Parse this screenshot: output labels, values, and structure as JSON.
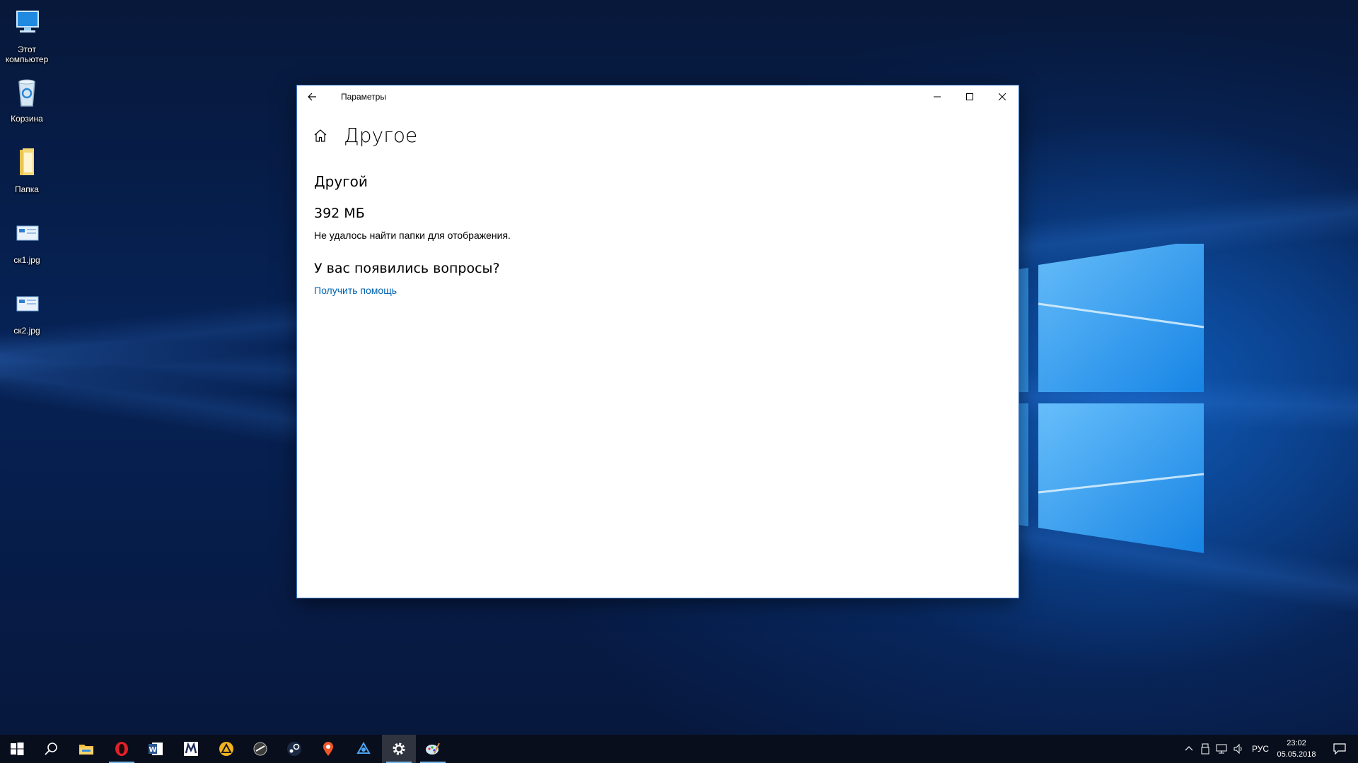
{
  "desktop": {
    "icons": [
      {
        "label": "Этот компьютер"
      },
      {
        "label": "Корзина"
      },
      {
        "label": "Папка"
      },
      {
        "label": "ск1.jpg"
      },
      {
        "label": "ск2.jpg"
      }
    ]
  },
  "window": {
    "title": "Параметры",
    "page_title": "Другое",
    "section_title": "Другой",
    "size_value": "392 МБ",
    "message": "Не удалось найти папки для отображения.",
    "questions_title": "У вас появились вопросы?",
    "help_link": "Получить помощь"
  },
  "taskbar": {
    "apps": [
      {
        "icon": "windows-start-icon"
      },
      {
        "icon": "search-icon"
      },
      {
        "icon": "file-explorer-icon"
      },
      {
        "icon": "opera-icon"
      },
      {
        "icon": "word-icon"
      },
      {
        "icon": "app-m-icon"
      },
      {
        "icon": "app-triangle-icon"
      },
      {
        "icon": "app-dark-icon"
      },
      {
        "icon": "steam-icon"
      },
      {
        "icon": "map-pin-icon"
      },
      {
        "icon": "app-blue-icon"
      },
      {
        "icon": "settings-gear-icon"
      },
      {
        "icon": "paint-icon"
      }
    ],
    "language": "РУС",
    "time": "23:02",
    "date": "05.05.2018"
  },
  "colors": {
    "accent": "#0063b1",
    "taskbar_indicator": "#76b9ed"
  }
}
